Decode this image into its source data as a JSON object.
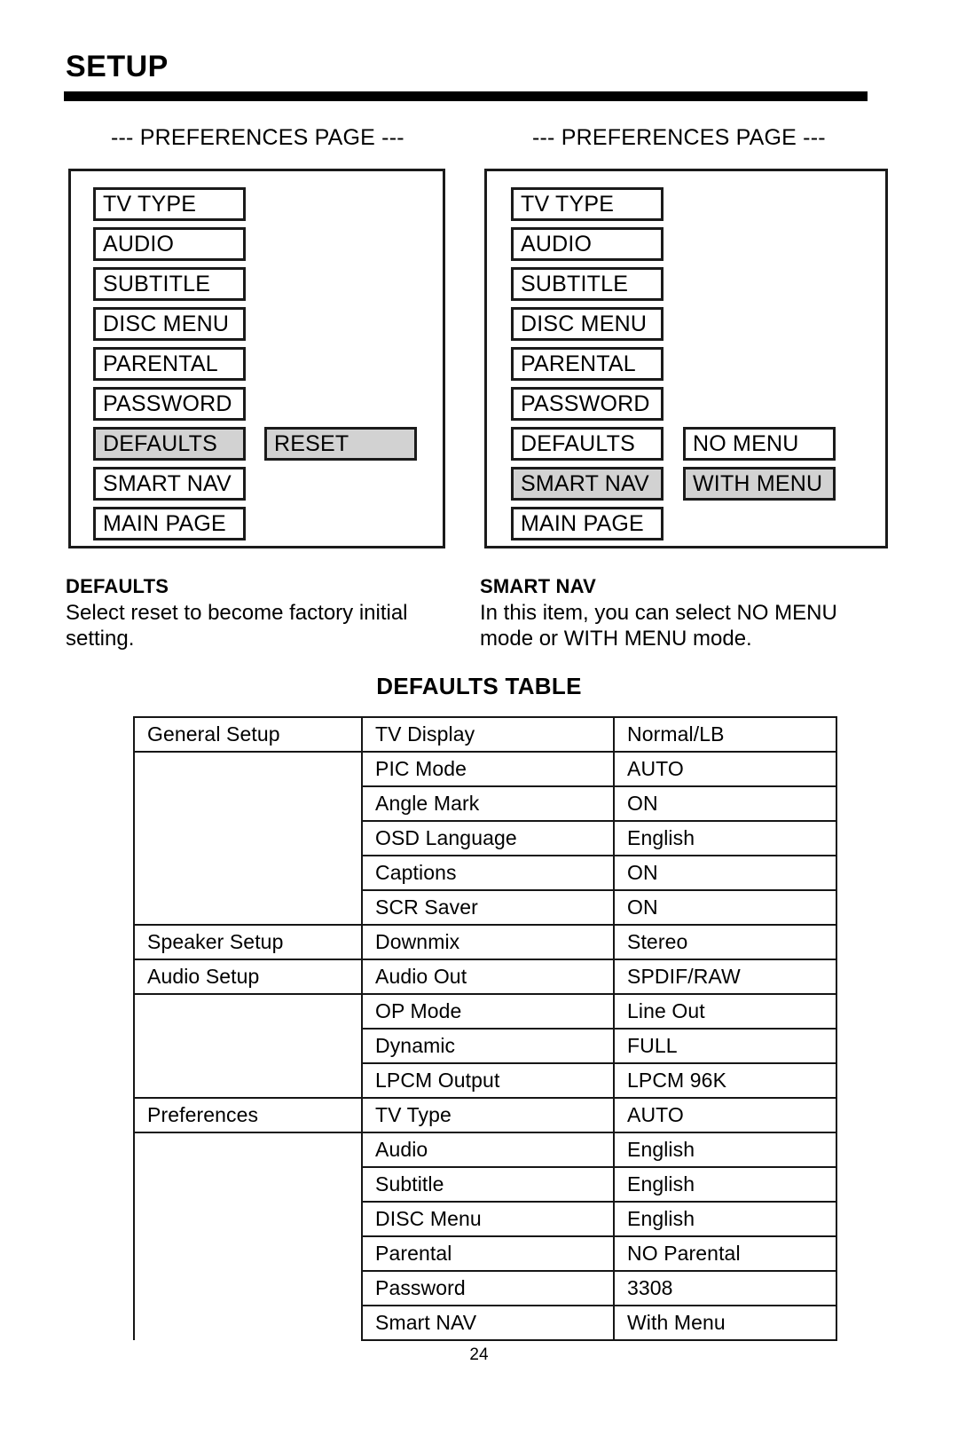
{
  "page": {
    "title": "SETUP",
    "number": "24"
  },
  "osd_left": {
    "caption": "--- PREFERENCES PAGE ---",
    "items": [
      {
        "label": "TV TYPE",
        "selected": false
      },
      {
        "label": "AUDIO",
        "selected": false
      },
      {
        "label": "SUBTITLE",
        "selected": false
      },
      {
        "label": "DISC MENU",
        "selected": false
      },
      {
        "label": "PARENTAL",
        "selected": false
      },
      {
        "label": "PASSWORD",
        "selected": false
      },
      {
        "label": "DEFAULTS",
        "selected": true
      },
      {
        "label": "SMART NAV",
        "selected": false
      },
      {
        "label": "MAIN PAGE",
        "selected": false
      }
    ],
    "options": [
      {
        "label": "RESET",
        "selected": true,
        "row": 6
      }
    ]
  },
  "osd_right": {
    "caption": "--- PREFERENCES PAGE ---",
    "items": [
      {
        "label": "TV TYPE",
        "selected": false
      },
      {
        "label": "AUDIO",
        "selected": false
      },
      {
        "label": "SUBTITLE",
        "selected": false
      },
      {
        "label": "DISC MENU",
        "selected": false
      },
      {
        "label": "PARENTAL",
        "selected": false
      },
      {
        "label": "PASSWORD",
        "selected": false
      },
      {
        "label": "DEFAULTS",
        "selected": false
      },
      {
        "label": "SMART NAV",
        "selected": true
      },
      {
        "label": "MAIN PAGE",
        "selected": false
      }
    ],
    "options": [
      {
        "label": "NO MENU",
        "selected": false,
        "row": 6
      },
      {
        "label": "WITH MENU",
        "selected": true,
        "row": 7
      }
    ]
  },
  "descriptions": [
    {
      "heading": "DEFAULTS",
      "body": "Select reset to become factory initial setting."
    },
    {
      "heading": "SMART NAV",
      "body": "In this item, you can select NO MENU mode or WITH MENU mode."
    }
  ],
  "defaults_table": {
    "title": "DEFAULTS TABLE",
    "rows": [
      {
        "group": "General Setup",
        "item": "TV Display",
        "value": "Normal/LB"
      },
      {
        "group": "",
        "item": "PIC Mode",
        "value": "AUTO"
      },
      {
        "group": "",
        "item": "Angle Mark",
        "value": "ON"
      },
      {
        "group": "",
        "item": "OSD Language",
        "value": "English"
      },
      {
        "group": "",
        "item": "Captions",
        "value": "ON"
      },
      {
        "group": "",
        "item": "SCR Saver",
        "value": "ON"
      },
      {
        "group": "Speaker Setup",
        "item": "Downmix",
        "value": "Stereo"
      },
      {
        "group": "Audio Setup",
        "item": "Audio Out",
        "value": "SPDIF/RAW"
      },
      {
        "group": "",
        "item": "OP Mode",
        "value": "Line Out"
      },
      {
        "group": "",
        "item": "Dynamic",
        "value": "FULL"
      },
      {
        "group": "",
        "item": "LPCM Output",
        "value": "LPCM 96K"
      },
      {
        "group": "Preferences",
        "item": "TV Type",
        "value": "AUTO"
      },
      {
        "group": "",
        "item": "Audio",
        "value": "English"
      },
      {
        "group": "",
        "item": "Subtitle",
        "value": "English"
      },
      {
        "group": "",
        "item": "DISC Menu",
        "value": "English"
      },
      {
        "group": "",
        "item": "Parental",
        "value": "NO Parental"
      },
      {
        "group": "",
        "item": "Password",
        "value": "3308"
      },
      {
        "group": "",
        "item": "Smart NAV",
        "value": "With Menu"
      }
    ]
  },
  "colors": {
    "selection_fill": "#d2d2d2",
    "rule": "#000000",
    "border": "#1b1b1b"
  }
}
